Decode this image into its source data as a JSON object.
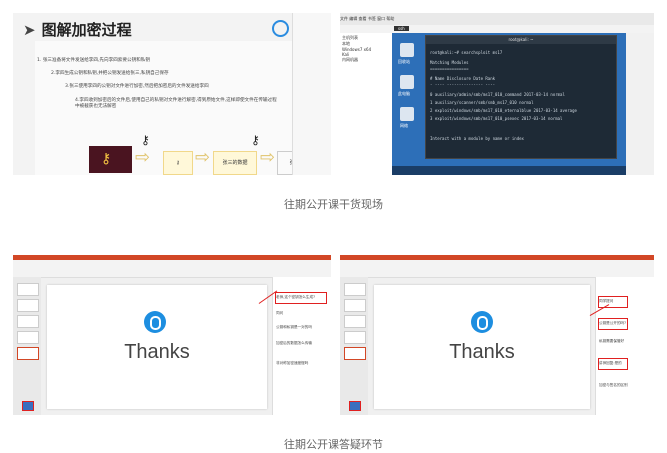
{
  "shot1": {
    "title": "图解加密过程",
    "bullets": [
      "1. 张三准备将文件发送给李四,先向李四索要公钥和私钥",
      "2.李四生成公钥和私钥,并把公钥发送给张三,私钥自己保存",
      "3.张三使用李四的公钥对文件进行加密,然后把加密后的文件发送给李四",
      "4.李四收到加密后的文件后,使用自己的私钥对文件进行解密,得到原始文件,这样即使文件在传输过程中被截获也无法解密"
    ],
    "box1": "张三的数据",
    "box2": "张三的数据"
  },
  "shot2": {
    "topbar": "文件 编辑 查看 书签 窗口 帮助",
    "tab": "ssh",
    "tree_items": [
      "主机列表",
      "本地",
      "Windows7 x64",
      "Kali",
      "内网机器"
    ],
    "desk_labels": [
      "回收站",
      "此电脑",
      "网络"
    ],
    "term_title": "root@kali: ~",
    "lines": [
      "root@kali:~# searchsploit ms17",
      "Matching Modules",
      "================",
      "  #  Name                          Disclosure Date  Rank",
      "  -  ----                          ---------------  ----",
      "  0  auxiliary/admin/smb/ms17_010_command 2017-03-14 normal",
      "  1  auxiliary/scanner/smb/smb_ms17_010               normal",
      "  2  exploit/windows/smb/ms17_010_eternalblue 2017-03-14 average",
      "  3  exploit/windows/smb/ms17_010_psexec 2017-03-14 normal",
      "Interact with a module by name or index"
    ]
  },
  "shot3": {
    "thanks": "Thanks",
    "messages": [
      "老师,这个密钥怎么生成?",
      "同问",
      "公钥和私钥是一对的吗",
      "加密后的数据怎么传输",
      "非对称加密速度慢吗"
    ]
  },
  "shot4": {
    "thanks": "Thanks",
    "messages": [
      "同学提问",
      "公钥是公开的吗?",
      "私钥需要保管好",
      "讲师回复:是的",
      "加密与签名的区别"
    ]
  },
  "captions": {
    "first": "往期公开课干货现场",
    "second": "往期公开课答疑环节"
  }
}
